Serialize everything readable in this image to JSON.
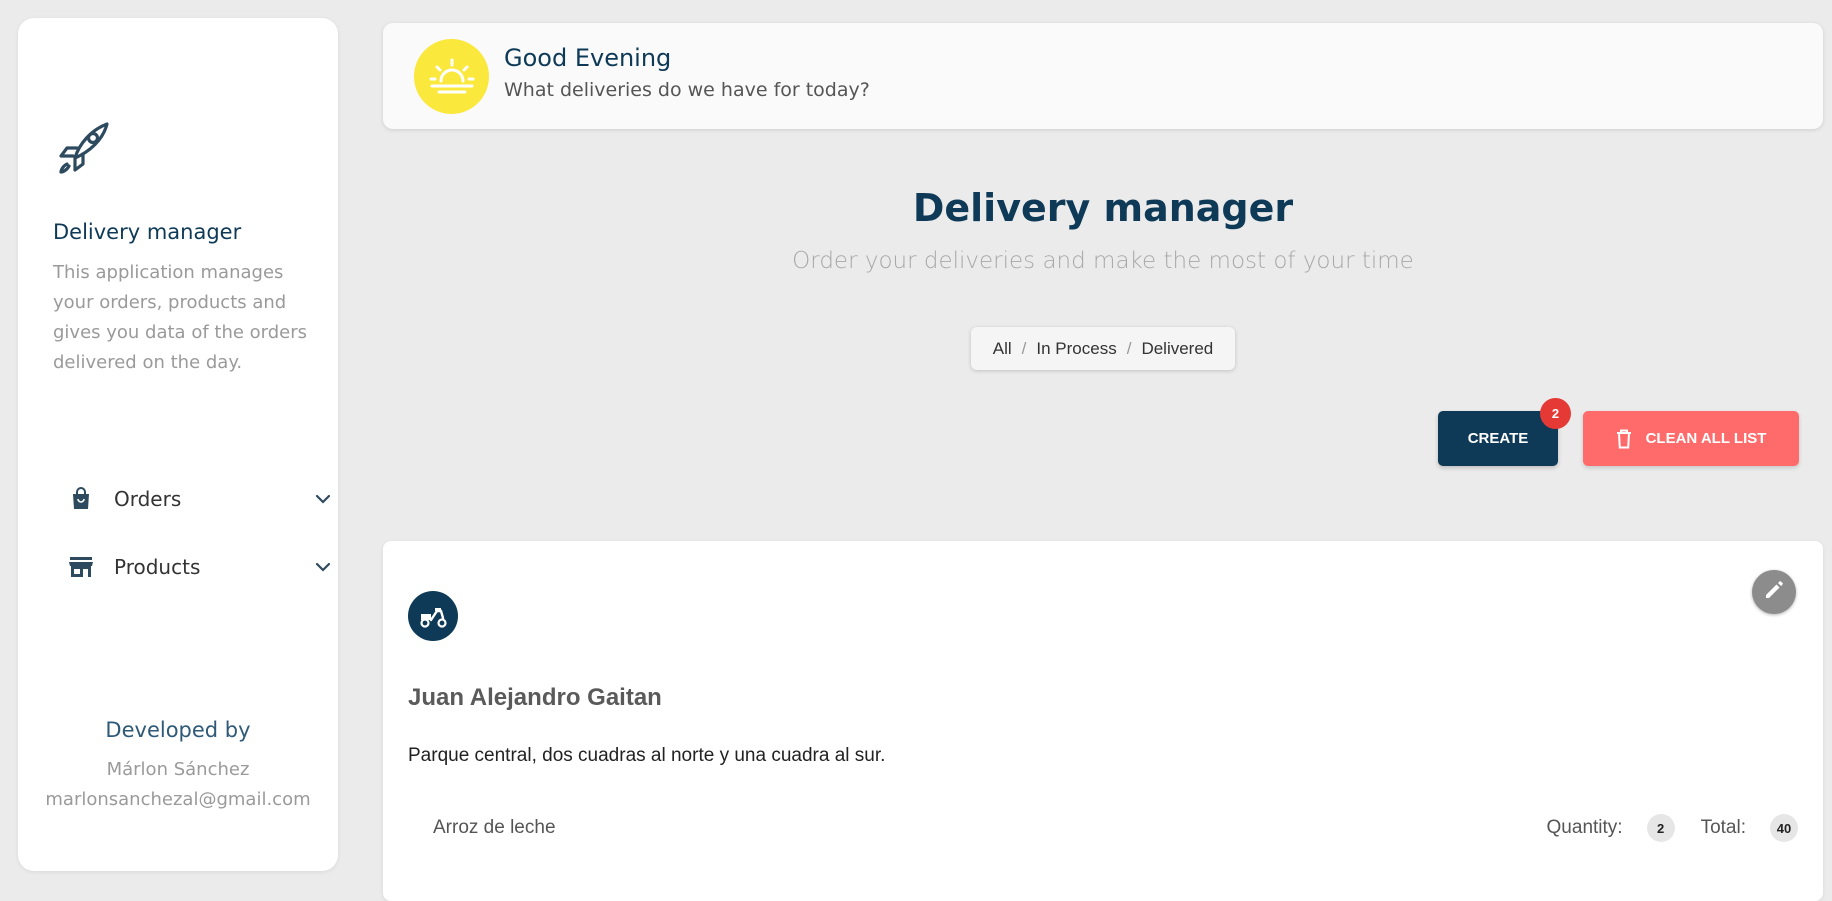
{
  "sidebar": {
    "app_name": "Delivery manager",
    "description": "This application manages your orders, products and gives you data of the orders delivered on the day.",
    "nav": [
      {
        "label": "Orders",
        "icon": "shopping-bag-icon"
      },
      {
        "label": "Products",
        "icon": "store-icon"
      }
    ],
    "developed_by": "Developed by",
    "developer_name": "Márlon Sánchez",
    "developer_email": "marlonsanchezal@gmail.com"
  },
  "greeting": {
    "title": "Good Evening",
    "subtitle": "What deliveries do we have for today?",
    "icon": "sunset-icon"
  },
  "header": {
    "title": "Delivery manager",
    "subtitle": "Order your deliveries and make the most of your time"
  },
  "filters": {
    "all": "All",
    "in_process": "In Process",
    "delivered": "Delivered",
    "separator": "/"
  },
  "actions": {
    "create_label": "CREATE",
    "create_badge": "2",
    "clean_label": "CLEAN ALL LIST"
  },
  "order": {
    "customer": "Juan Alejandro Gaitan",
    "address": "Parque central, dos cuadras al norte y una cuadra al sur.",
    "quantity_label": "Quantity:",
    "total_label": "Total:",
    "items": [
      {
        "name": "Arroz de leche",
        "quantity": "2",
        "total": "40"
      }
    ]
  },
  "colors": {
    "primary": "#0e3a57",
    "danger": "#ff6b6b",
    "badge": "#e53935",
    "sun": "#fbe83c"
  }
}
